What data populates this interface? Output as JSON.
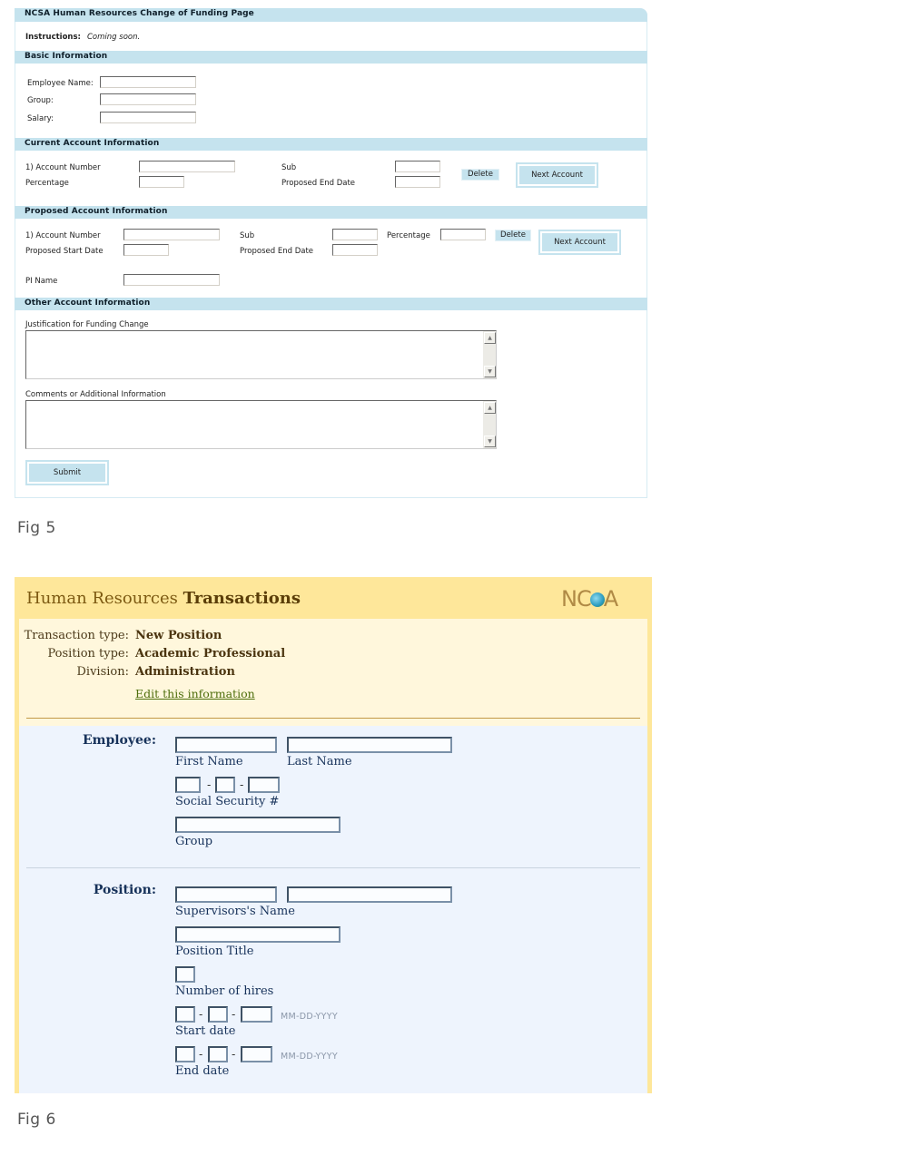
{
  "fig5": {
    "title": "NCSA Human Resources Change of Funding Page",
    "instructions_label": "Instructions:",
    "instructions_text": "Coming soon.",
    "basic": {
      "heading": "Basic Information",
      "employee_name_label": "Employee Name:",
      "group_label": "Group:",
      "salary_label": "Salary:",
      "employee_name_value": "",
      "group_value": "",
      "salary_value": ""
    },
    "current": {
      "heading": "Current Account Information",
      "account_number_label": "1) Account Number",
      "percentage_label": "Percentage",
      "sub_label": "Sub",
      "proposed_end_date_label": "Proposed End Date",
      "delete_label": "Delete",
      "next_account_label": "Next Account"
    },
    "proposed": {
      "heading": "Proposed Account Information",
      "account_number_label": "1) Account Number",
      "proposed_start_date_label": "Proposed Start Date",
      "sub_label": "Sub",
      "proposed_end_date_label": "Proposed End Date",
      "percentage_label": "Percentage",
      "delete_label": "Delete",
      "next_account_label": "Next Account",
      "pi_name_label": "PI Name"
    },
    "other": {
      "heading": "Other Account Information",
      "justification_label": "Justification for Funding Change",
      "comments_label": "Comments or Additional Information",
      "justification_value": "",
      "comments_value": ""
    },
    "submit_label": "Submit",
    "scroll_up_glyph": "▲",
    "scroll_down_glyph": "▼"
  },
  "fig5_caption": "Fig 5",
  "fig6": {
    "header_title_light": "Human Resources ",
    "header_title_bold": "Transactions",
    "logo_left": "NC",
    "logo_right": "A",
    "summary": [
      {
        "label": "Transaction type:",
        "value": "New Position"
      },
      {
        "label": "Position type:",
        "value": "Academic Professional"
      },
      {
        "label": "Division:",
        "value": "Administration"
      }
    ],
    "edit_link": "Edit this information",
    "employee": {
      "heading": "Employee:",
      "first_name_label": "First Name",
      "last_name_label": "Last Name",
      "ssn_label": "Social Security #",
      "group_label": "Group",
      "separator": "-"
    },
    "position": {
      "heading": "Position:",
      "supervisor_label": "Supervisors's Name",
      "title_label": "Position Title",
      "hires_label": "Number of hires",
      "start_date_label": "Start date",
      "end_date_label": "End date",
      "date_hint": "MM-DD-YYYY",
      "separator": "-"
    }
  },
  "fig6_caption": "Fig 6",
  "colors": {
    "fig5_bar": "#c5e3ee",
    "fig6_header": "#fee79a",
    "fig6_info_bg": "#fff7dc",
    "fig6_form_bg": "#eef4fd",
    "fig6_label": "#17325a",
    "fig6_link": "#4d6e0c"
  }
}
